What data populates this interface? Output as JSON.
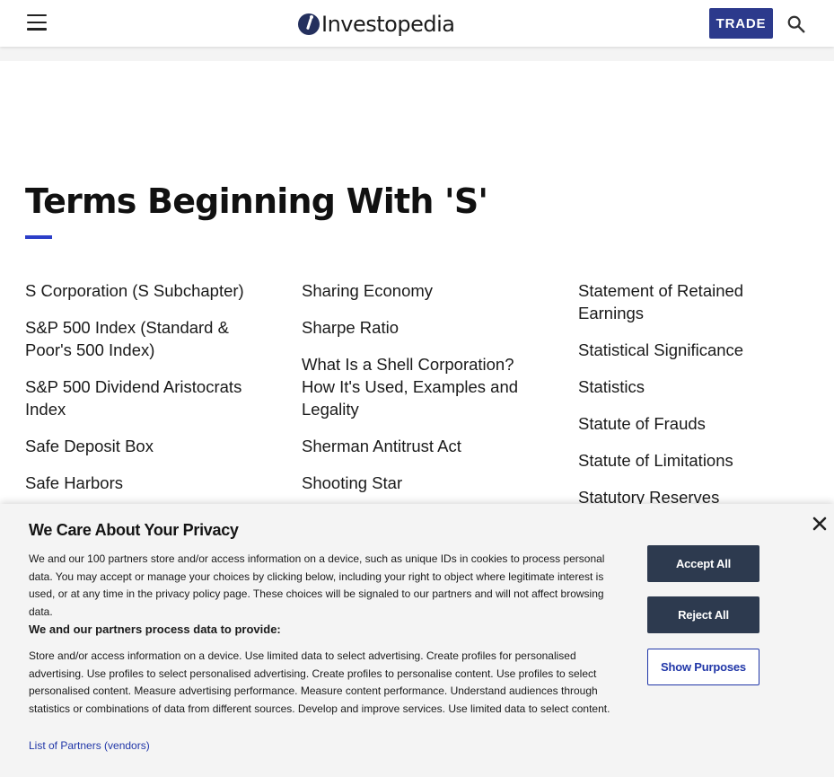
{
  "header": {
    "logo_text": "Investopedia",
    "trade_label": "TRADE"
  },
  "page": {
    "title": "Terms Beginning With 'S'"
  },
  "terms": {
    "col1": [
      "S Corporation (S Subchapter)",
      "S&P 500 Index (Standard & Poor's 500 Index)",
      "S&P 500 Dividend Aristocrats Index",
      "Safe Deposit Box",
      "Safe Harbors"
    ],
    "col2": [
      "Sharing Economy",
      "Sharpe Ratio",
      "What Is a Shell Corporation? How It's Used, Examples and Legality",
      "Sherman Antitrust Act",
      "Shooting Star"
    ],
    "col3": [
      "Statement of Retained Earnings",
      "Statistical Significance",
      "Statistics",
      "Statute of Frauds",
      "Statute of Limitations",
      "Statutory Reserves"
    ]
  },
  "privacy": {
    "title": "We Care About Your Privacy",
    "intro": "We and our 100 partners store and/or access information on a device, such as unique IDs in cookies to process personal data. You may accept or manage your choices by clicking below, including your right to object where legitimate interest is used, or at any time in the privacy policy page. These choices will be signaled to our partners and will not affect browsing data.",
    "subheading": "We and our partners process data to provide:",
    "purposes": "Store and/or access information on a device. Use limited data to select advertising. Create profiles for personalised advertising. Use profiles to select personalised advertising. Create profiles to personalise content. Use profiles to select personalised content. Measure advertising performance. Measure content performance. Understand audiences through statistics or combinations of data from different sources. Develop and improve services. Use limited data to select content.",
    "partners_link": "List of Partners (vendors)",
    "accept_label": "Accept All",
    "reject_label": "Reject All",
    "show_purposes_label": "Show Purposes"
  },
  "colors": {
    "brand_navy": "#2c3a8c",
    "accent_blue": "#2c3ec8",
    "button_dark": "#2d3a4f",
    "link_blue": "#2137a8"
  }
}
